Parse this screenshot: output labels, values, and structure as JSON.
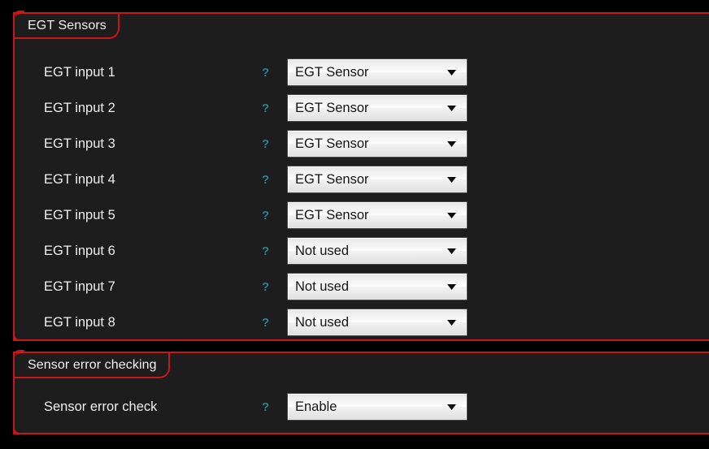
{
  "theme": {
    "background": "#000000",
    "panel_fill": "#1d1d1d",
    "accent_border": "#c8161d",
    "label_text": "#efefef",
    "help_icon_color": "#2f7f91",
    "dropdown_text": "#141414"
  },
  "panels": [
    {
      "id": "egt-sensors",
      "title": "EGT Sensors",
      "rows": [
        {
          "label": "EGT input 1",
          "help": "?",
          "value": "EGT Sensor"
        },
        {
          "label": "EGT input 2",
          "help": "?",
          "value": "EGT Sensor"
        },
        {
          "label": "EGT input 3",
          "help": "?",
          "value": "EGT Sensor"
        },
        {
          "label": "EGT input 4",
          "help": "?",
          "value": "EGT Sensor"
        },
        {
          "label": "EGT input 5",
          "help": "?",
          "value": "EGT Sensor"
        },
        {
          "label": "EGT input 6",
          "help": "?",
          "value": "Not used"
        },
        {
          "label": "EGT input 7",
          "help": "?",
          "value": "Not used"
        },
        {
          "label": "EGT input 8",
          "help": "?",
          "value": "Not used"
        }
      ]
    },
    {
      "id": "sensor-error-checking",
      "title": "Sensor error checking",
      "rows": [
        {
          "label": "Sensor error check",
          "help": "?",
          "value": "Enable"
        }
      ]
    }
  ],
  "icons": {
    "dropdown_arrow": "chevron-down-icon",
    "help": "question-mark-icon"
  }
}
